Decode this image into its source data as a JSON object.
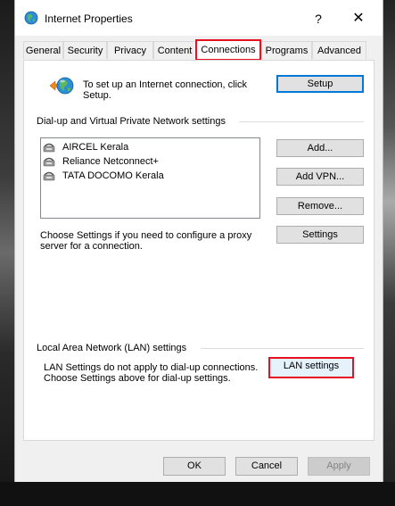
{
  "window": {
    "title": "Internet Properties",
    "help_glyph": "?",
    "close_glyph": "✕"
  },
  "tabs": [
    {
      "label": "General"
    },
    {
      "label": "Security"
    },
    {
      "label": "Privacy"
    },
    {
      "label": "Content"
    },
    {
      "label": "Connections",
      "active": true
    },
    {
      "label": "Programs"
    },
    {
      "label": "Advanced"
    }
  ],
  "setup": {
    "text_line1": "To set up an Internet connection, click",
    "text_line2": "Setup.",
    "button": "Setup"
  },
  "dialup": {
    "group_title": "Dial-up and Virtual Private Network settings",
    "connections": [
      "AIRCEL Kerala",
      "Reliance Netconnect+",
      "TATA DOCOMO Kerala"
    ],
    "add_button": "Add...",
    "add_vpn_button": "Add VPN...",
    "remove_button": "Remove...",
    "settings_text_line1": "Choose Settings if you need to configure a proxy",
    "settings_text_line2": "server for a connection.",
    "settings_button": "Settings"
  },
  "lan": {
    "group_title": "Local Area Network (LAN) settings",
    "text_line1": "LAN Settings do not apply to dial-up connections.",
    "text_line2": "Choose Settings above for dial-up settings.",
    "button": "LAN settings"
  },
  "footer": {
    "ok": "OK",
    "cancel": "Cancel",
    "apply": "Apply"
  },
  "colors": {
    "highlight": "#e81123",
    "focus_blue": "#0078d7"
  }
}
